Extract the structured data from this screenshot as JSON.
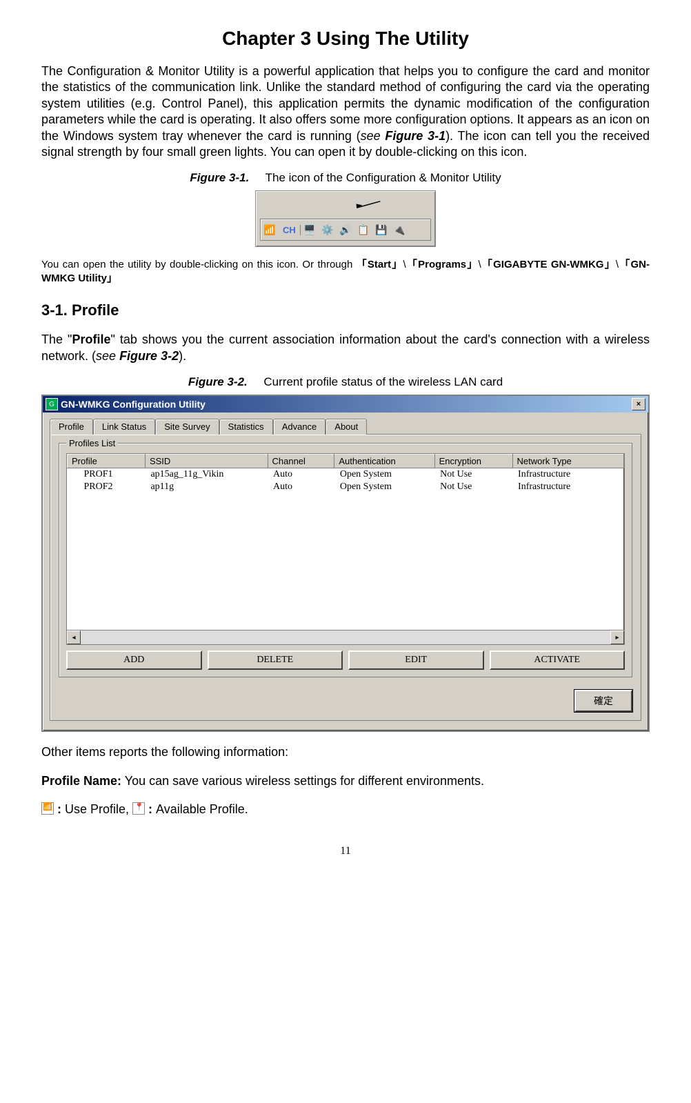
{
  "chapter_title": "Chapter 3    Using The Utility",
  "intro_para_pre": "The Configuration & Monitor Utility is a powerful application that helps you to configure the card and monitor the statistics of the communication link. Unlike the standard method of configuring the card via the operating system utilities (e.g. Control Panel), this application permits the dynamic modification of the configuration parameters while the card is operating. It also offers some more configuration options. It appears as an icon on the Windows system tray whenever the card is running (",
  "intro_see": "see ",
  "intro_figref": "Figure 3-1",
  "intro_para_post": "). The icon can tell you the received signal strength by four small green lights. You can open it by double-clicking on this icon.",
  "figure_3_1": {
    "num": "Figure 3-1.",
    "caption": "The icon of the Configuration & Monitor Utility"
  },
  "tray_lang_label": "CH",
  "open_note_pt1": "You can open the utility by double-clicking on this icon. Or through  ",
  "open_note_start": "「Start」",
  "open_note_sep": "\\",
  "open_note_programs": "「Programs」",
  "open_note_gigabyte": "「GIGABYTE GN-WMKG」",
  "open_note_utility": "「GN-WMKG Utility」",
  "section_3_1": "3-1.    Profile",
  "profile_para_pre": "The \"",
  "profile_word": "Profile",
  "profile_para_mid": "\" tab shows you the current association information about the card's connection with a wireless network. (",
  "profile_see": "see ",
  "profile_figref": "Figure 3-2",
  "profile_para_post": ").",
  "figure_3_2": {
    "num": "Figure 3-2.",
    "caption": "Current profile status of the wireless LAN card"
  },
  "dialog": {
    "title": "GN-WMKG Configuration Utility",
    "close_x": "×",
    "tabs": [
      "Profile",
      "Link Status",
      "Site Survey",
      "Statistics",
      "Advance",
      "About"
    ],
    "groupbox": "Profiles List",
    "columns": [
      "Profile",
      "SSID",
      "Channel",
      "Authentication",
      "Encryption",
      "Network Type"
    ],
    "rows": [
      {
        "profile": "PROF1",
        "ssid": "ap15ag_11g_Vikin",
        "channel": "Auto",
        "auth": "Open System",
        "enc": "Not Use",
        "net": "Infrastructure"
      },
      {
        "profile": "PROF2",
        "ssid": "ap11g",
        "channel": "Auto",
        "auth": "Open System",
        "enc": "Not Use",
        "net": "Infrastructure"
      }
    ],
    "buttons": [
      "ADD",
      "DELETE",
      "EDIT",
      "ACTIVATE"
    ],
    "ok_btn": "確定"
  },
  "other_items_intro": "Other items reports the following information:",
  "profile_name_label": "Profile Name:",
  "profile_name_desc": " You can save various wireless settings for different environments.",
  "use_profile_sep": " : ",
  "use_profile_text": "Use Profile, ",
  "avail_profile_text": " : Available Profile.",
  "page_number": "11"
}
